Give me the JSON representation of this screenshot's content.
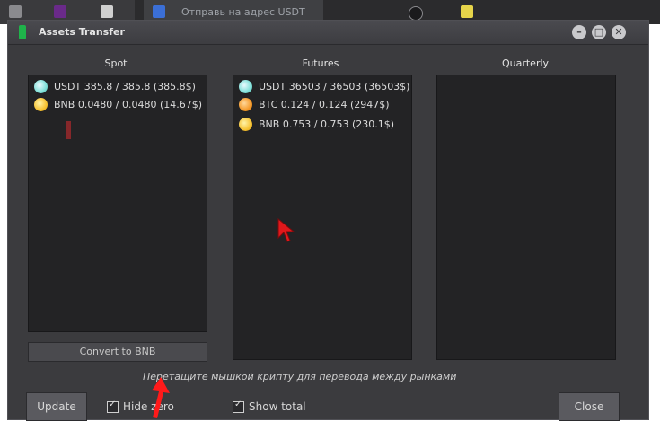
{
  "taskbar": {
    "text": "Отправь на адрес USDT"
  },
  "window": {
    "title": "Assets Transfer",
    "min_label": "–",
    "max_label": "□",
    "close_label": "✕"
  },
  "columns": {
    "spot": {
      "header": "Spot",
      "items": [
        {
          "coin": "usdt",
          "text": "USDT  385.8 / 385.8 (385.8$)"
        },
        {
          "coin": "bnb",
          "text": "BNB  0.0480 / 0.0480 (14.67$)"
        }
      ]
    },
    "futures": {
      "header": "Futures",
      "items": [
        {
          "coin": "usdt",
          "text": "USDT  36503 / 36503 (36503$)"
        },
        {
          "coin": "btc",
          "text": "BTC  0.124 / 0.124 (2947$)"
        },
        {
          "coin": "bnb",
          "text": "BNB  0.753 / 0.753 (230.1$)"
        }
      ]
    },
    "quarterly": {
      "header": "Quarterly",
      "items": []
    }
  },
  "actions": {
    "convert_label": "Convert to BNB",
    "hint": "Перетащите мышкой крипту для перевода между рынками",
    "update_label": "Update",
    "hide_zero_label": "Hide zero",
    "show_total_label": "Show total",
    "close_label": "Close"
  },
  "colors": {
    "accent_red": "#e0181b",
    "panel_bg": "#3b3b3e",
    "list_bg": "#232325"
  }
}
